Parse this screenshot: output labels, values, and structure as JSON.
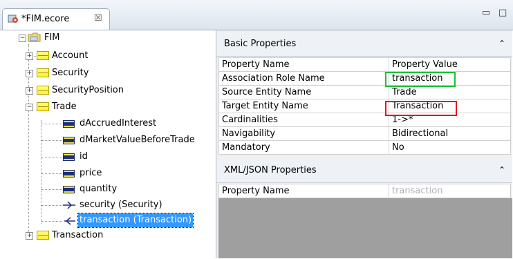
{
  "tab": {
    "title": "*FIM.ecore",
    "close": "☒",
    "icon": "ecore-file-icon"
  },
  "window_buttons": {
    "minimize": "▭",
    "maximize": "□"
  },
  "tree": {
    "root": {
      "label": "FIM",
      "icon": "package-icon",
      "state": "expanded"
    },
    "items": [
      {
        "label": "Account",
        "icon": "class-icon",
        "state": "collapsed"
      },
      {
        "label": "Security",
        "icon": "class-icon",
        "state": "collapsed"
      },
      {
        "label": "SecurityPosition",
        "icon": "class-icon",
        "state": "collapsed"
      },
      {
        "label": "Trade",
        "icon": "class-icon",
        "state": "expanded"
      },
      {
        "label": "dAccruedInterest",
        "icon": "attribute-icon"
      },
      {
        "label": "dMarketValueBeforeTrade",
        "icon": "attribute-icon"
      },
      {
        "label": "id",
        "icon": "attribute-icon"
      },
      {
        "label": "price",
        "icon": "attribute-icon"
      },
      {
        "label": "quantity",
        "icon": "attribute-icon"
      },
      {
        "label": "security (Security)",
        "icon": "reference-out-icon"
      },
      {
        "label": "transaction (Transaction)",
        "icon": "reference-in-icon",
        "selected": true
      },
      {
        "label": "Transaction",
        "icon": "class-icon",
        "state": "collapsed"
      }
    ]
  },
  "basic_properties": {
    "title": "Basic Properties",
    "caret": "⌃",
    "header": {
      "name": "Property Name",
      "value": "Property Value"
    },
    "rows": [
      {
        "name": "Association Role Name",
        "value": "transaction"
      },
      {
        "name": "Source Entity Name",
        "value": "Trade"
      },
      {
        "name": "Target Entity Name",
        "value": "Transaction"
      },
      {
        "name": "Cardinalities",
        "value": "1->*"
      },
      {
        "name": "Navigability",
        "value": "Bidirectional"
      },
      {
        "name": "Mandatory",
        "value": "No"
      }
    ]
  },
  "xml_properties": {
    "title": "XML/JSON Properties",
    "caret": "⌃",
    "rows": [
      {
        "name": "Property Name",
        "value": "transaction"
      }
    ]
  },
  "colors": {
    "highlight_green": "#1fbf3a",
    "highlight_red": "#e01919",
    "selection": "#3399ff"
  }
}
